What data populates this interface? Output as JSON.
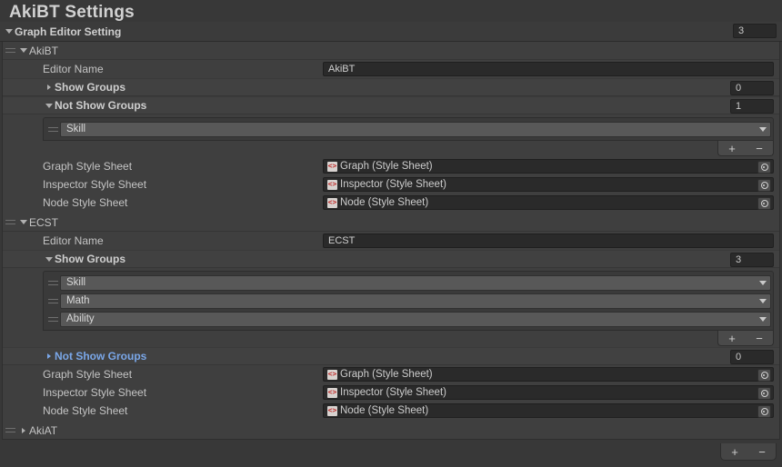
{
  "window": {
    "title": "AkiBT Settings"
  },
  "root_foldout": {
    "label": "Graph Editor Setting",
    "count": "3",
    "expanded": true
  },
  "labels": {
    "editor_name": "Editor Name",
    "show_groups": "Show Groups",
    "not_show_groups": "Not Show Groups",
    "graph_style_sheet": "Graph Style Sheet",
    "inspector_style_sheet": "Inspector Style Sheet",
    "node_style_sheet": "Node Style Sheet"
  },
  "buttons": {
    "add": "+",
    "remove": "−"
  },
  "editors": [
    {
      "name": "AkiBT",
      "expanded": true,
      "editor_name_value": "AkiBT",
      "show_groups": {
        "label": "Show Groups",
        "expanded": false,
        "count": "0",
        "highlighted": false,
        "items": []
      },
      "not_show_groups": {
        "label": "Not Show Groups",
        "expanded": true,
        "count": "1",
        "highlighted": false,
        "items": [
          "Skill"
        ]
      },
      "style_sheets": [
        {
          "label": "Graph Style Sheet",
          "value": "Graph (Style Sheet)"
        },
        {
          "label": "Inspector Style Sheet",
          "value": "Inspector (Style Sheet)"
        },
        {
          "label": "Node Style Sheet",
          "value": "Node (Style Sheet)"
        }
      ]
    },
    {
      "name": "ECST",
      "expanded": true,
      "editor_name_value": "ECST",
      "show_groups": {
        "label": "Show Groups",
        "expanded": true,
        "count": "3",
        "highlighted": false,
        "items": [
          "Skill",
          "Math",
          "Ability"
        ]
      },
      "not_show_groups": {
        "label": "Not Show Groups",
        "expanded": false,
        "count": "0",
        "highlighted": true,
        "items": []
      },
      "style_sheets": [
        {
          "label": "Graph Style Sheet",
          "value": "Graph (Style Sheet)"
        },
        {
          "label": "Inspector Style Sheet",
          "value": "Inspector (Style Sheet)"
        },
        {
          "label": "Node Style Sheet",
          "value": "Node (Style Sheet)"
        }
      ]
    },
    {
      "name": "AkiAT",
      "expanded": false,
      "collapsed_only": true
    }
  ],
  "icons": {
    "style_sheet_icon": "style-sheet-icon",
    "object_picker_icon": "object-picker-icon",
    "drag_handle_icon": "drag-handle-icon",
    "foldout_arrow_icon": "foldout-arrow-icon",
    "dropdown_arrow_icon": "chevron-down-icon"
  },
  "colors": {
    "background": "#383838",
    "panel": "#3f3f3f",
    "field": "#2a2a2a",
    "accent_blue": "#7aa7e8",
    "text": "#c4c4c4"
  }
}
